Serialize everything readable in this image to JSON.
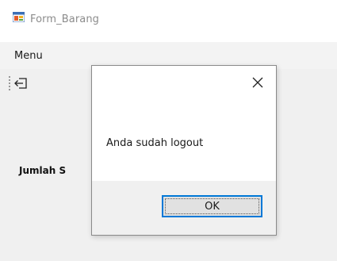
{
  "window": {
    "title": "Form_Barang",
    "icon": "windows-form-icon"
  },
  "menubar": {
    "items": [
      {
        "label": "Menu"
      }
    ]
  },
  "toolbar": {
    "logout_icon": "logout-icon"
  },
  "form": {
    "jumlah_label": "Jumlah S"
  },
  "dialog": {
    "message": "Anda sudah logout",
    "ok_label": "OK",
    "close_icon": "close-icon"
  },
  "colors": {
    "accent": "#0078d7",
    "window_bg": "#f0f0f0",
    "dialog_bg": "#ffffff"
  }
}
